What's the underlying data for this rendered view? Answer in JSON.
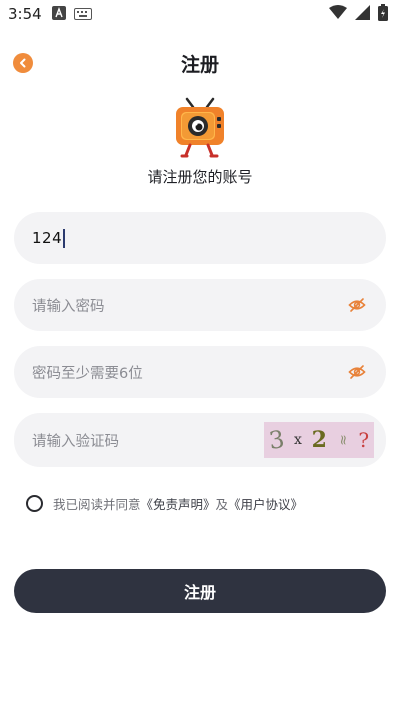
{
  "status_bar": {
    "time": "3:54"
  },
  "header": {
    "title": "注册"
  },
  "subtitle": "请注册您的账号",
  "form": {
    "username_value": "124",
    "password_placeholder": "请输入密码",
    "confirm_placeholder": "密码至少需要6位",
    "captcha_placeholder": "请输入验证码",
    "captcha_chars": [
      "3",
      "x",
      "2",
      "≈",
      "?"
    ]
  },
  "agreement": {
    "prefix": "我已阅读并同意",
    "disclaimer_link": "《免责声明》",
    "joiner": "及",
    "terms_link": "《用户协议》",
    "checked": false
  },
  "submit_label": "注册",
  "colors": {
    "accent": "#f08c3c",
    "button_dark": "#2f3340",
    "field_bg": "#f3f3f5",
    "captcha_bg": "#e8cfe0"
  }
}
